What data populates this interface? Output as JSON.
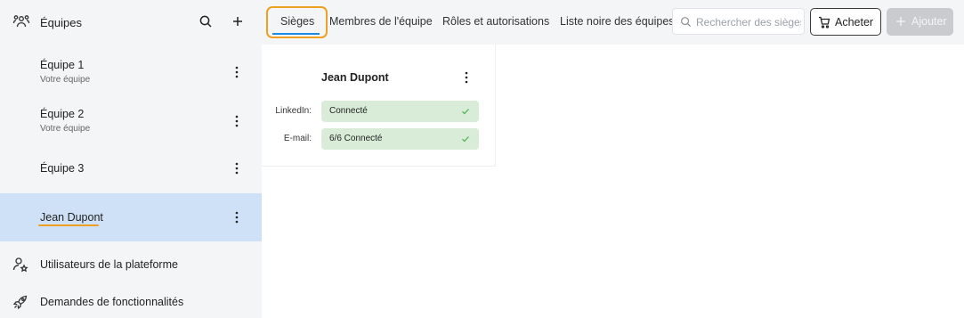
{
  "sidebar": {
    "title": "Équipes",
    "teams": [
      {
        "name": "Équipe 1",
        "subtitle": "Votre équipe"
      },
      {
        "name": "Équipe 2",
        "subtitle": "Votre équipe"
      },
      {
        "name": "Équipe 3",
        "subtitle": ""
      },
      {
        "name": "Jean Dupont",
        "subtitle": ""
      }
    ],
    "nav": [
      {
        "label": "Utilisateurs de la plateforme",
        "icon": "user-star-icon"
      },
      {
        "label": "Demandes de fonctionnalités",
        "icon": "rocket-icon"
      }
    ]
  },
  "tabs": [
    {
      "label": "Sièges",
      "active": true
    },
    {
      "label": "Membres de l'équipe"
    },
    {
      "label": "Rôles et autorisations"
    },
    {
      "label": "Liste noire des équipes"
    }
  ],
  "search": {
    "placeholder": "Rechercher des sièges"
  },
  "toolbar": {
    "buy_label": "Acheter",
    "add_label": "Ajouter"
  },
  "card": {
    "name": "Jean Dupont",
    "rows": [
      {
        "label": "LinkedIn:",
        "value": "Connecté"
      },
      {
        "label": "E-mail:",
        "value": "6/6 Connecté"
      }
    ]
  },
  "colors": {
    "accent_blue": "#1e88e5",
    "highlight_orange": "#f0a020",
    "selected_bg": "#cfe1f6",
    "status_green_bg": "#d8ecd8",
    "check_green": "#4caf50"
  }
}
